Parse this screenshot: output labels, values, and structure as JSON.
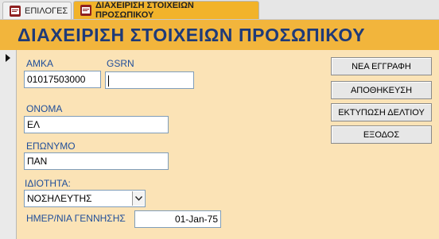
{
  "tabs": [
    {
      "label": "ΕΠΙΛΟΓΕΣ",
      "active": false
    },
    {
      "label": "ΔΙΑΧΕΙΡΙΣΗ ΣΤΟΙΧΕΙΩΝ ΠΡΟΣΩΠΙΚΟΥ",
      "active": true
    }
  ],
  "form": {
    "title": "ΔΙΑΧΕΙΡΙΣΗ ΣΤΟΙΧΕΙΩΝ ΠΡΟΣΩΠΙΚΟΥ",
    "fields": {
      "amka": {
        "label": "ΑΜΚΑ",
        "value": "01017503000"
      },
      "gsrn": {
        "label": "GSRN",
        "value": ""
      },
      "onoma": {
        "label": "ΟΝΟΜΑ",
        "value": "ΕΛ"
      },
      "eponymo": {
        "label": "ΕΠΩΝΥΜΟ",
        "value": "ΠΑΝ"
      },
      "idiotita": {
        "label": "ΙΔΙΟΤΗΤΑ:",
        "value": "ΝΟΣΗΛΕΥΤΗΣ"
      },
      "birthdate": {
        "label": "ΗΜΕΡ/ΝΙΑ ΓΕΝΝΗΣΗΣ",
        "value": "01-Jan-75"
      }
    },
    "buttons": {
      "new_record": "ΝΕΑ ΕΓΓΡΑΦΗ",
      "save": "ΑΠΟΘΗΚΕΥΣΗ",
      "print": "ΕΚΤΥΠΩΣΗ ΔΕΛΤΙΟΥ",
      "exit": "ΕΞΟΔΟΣ"
    }
  },
  "icons": {
    "tab_icon": "form-icon",
    "record_selector": "current-record-arrow-icon",
    "combo": "chevron-down-icon"
  },
  "colors": {
    "header_band": "#f2b53c",
    "form_background": "#fbe3b6",
    "title_text": "#1e3a78",
    "label_text": "#1f4e9a",
    "active_tab": "#f2b32a"
  }
}
